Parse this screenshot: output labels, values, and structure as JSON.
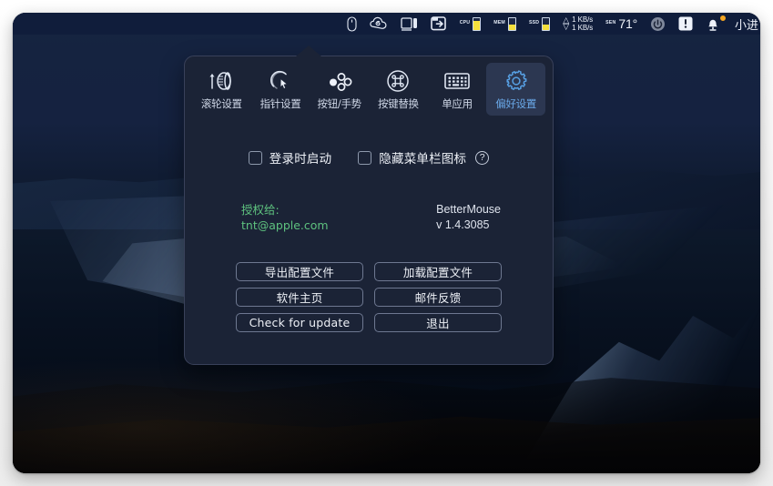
{
  "menubar": {
    "items": [
      {
        "name": "mouse-icon",
        "type": "icon"
      },
      {
        "name": "cloud-icon",
        "type": "icon"
      },
      {
        "name": "window-split-icon",
        "type": "icon"
      },
      {
        "name": "export-icon",
        "type": "icon"
      }
    ],
    "stats": [
      {
        "label": "CPU",
        "fill_pct": 72,
        "color": "#f5e03c"
      },
      {
        "label": "MEM",
        "fill_pct": 45,
        "color": "#f5e03c"
      },
      {
        "label": "SSD",
        "fill_pct": 40,
        "color": "#f5e03c"
      }
    ],
    "network": {
      "up": "1 KB/s",
      "down": "1 KB/s",
      "arrow_up": "△",
      "arrow_down": "▽"
    },
    "sensor": {
      "label": "SEN",
      "value": "71°"
    },
    "right_icons": [
      {
        "name": "power-circle-icon"
      },
      {
        "name": "alert-square-icon"
      },
      {
        "name": "notification-bell-icon",
        "badge": true
      }
    ],
    "user_label": "小进"
  },
  "popover": {
    "tabs": [
      {
        "id": "scroll",
        "label": "滚轮设置",
        "icon": "scroll-wheel-icon",
        "selected": false
      },
      {
        "id": "pointer",
        "label": "指针设置",
        "icon": "pointer-cursor-icon",
        "selected": false
      },
      {
        "id": "buttons",
        "label": "按钮/手势",
        "icon": "buttons-gesture-icon",
        "selected": false
      },
      {
        "id": "keys",
        "label": "按键替换",
        "icon": "command-key-icon",
        "selected": false
      },
      {
        "id": "singleapp",
        "label": "单应用",
        "icon": "keyboard-icon",
        "selected": false
      },
      {
        "id": "prefs",
        "label": "偏好设置",
        "icon": "gear-icon",
        "selected": true
      }
    ],
    "checkboxes": [
      {
        "id": "launch-at-login",
        "label": "登录时启动",
        "checked": false,
        "help": false
      },
      {
        "id": "hide-menubar-icon",
        "label": "隐藏菜单栏图标",
        "checked": false,
        "help": true,
        "help_glyph": "?"
      }
    ],
    "license": {
      "title": "授权给:",
      "email": "tnt@apple.com",
      "color": "#5ec27f"
    },
    "app": {
      "name": "BetterMouse",
      "version": "v 1.4.3085"
    },
    "buttons": [
      {
        "id": "export-config",
        "label": "导出配置文件"
      },
      {
        "id": "load-config",
        "label": "加载配置文件"
      },
      {
        "id": "homepage",
        "label": "软件主页"
      },
      {
        "id": "mail-feedback",
        "label": "邮件反馈"
      },
      {
        "id": "check-update",
        "label": "Check for update"
      },
      {
        "id": "quit",
        "label": "退出"
      }
    ]
  },
  "theme": {
    "popover_bg": "#1b2336",
    "menubar_bg": "#101d3b",
    "accent_blue": "#6aa8e8",
    "selected_tab_bg": "#2c3751",
    "badge_orange": "#f5a623"
  }
}
